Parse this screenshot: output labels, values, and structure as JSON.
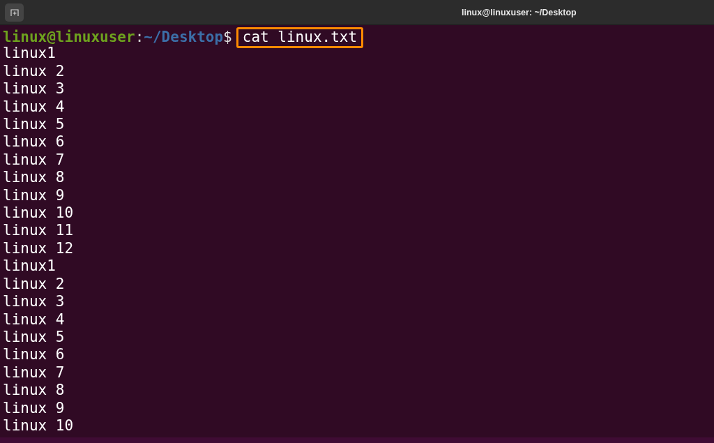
{
  "window": {
    "title": "linux@linuxuser: ~/Desktop"
  },
  "prompt": {
    "user_host": "linux@linuxuser",
    "separator": ":",
    "path": "~/Desktop",
    "symbol": "$",
    "command": "cat linux.txt",
    "highlighted": true
  },
  "output": [
    "linux1",
    "linux 2",
    "linux 3",
    "linux 4",
    "linux 5",
    "linux 6",
    "linux 7",
    "linux 8",
    "linux 9",
    "linux 10",
    "linux 11",
    "linux 12",
    "linux1",
    "linux 2",
    "linux 3",
    "linux 4",
    "linux 5",
    "linux 6",
    "linux 7",
    "linux 8",
    "linux 9",
    "linux 10"
  ]
}
